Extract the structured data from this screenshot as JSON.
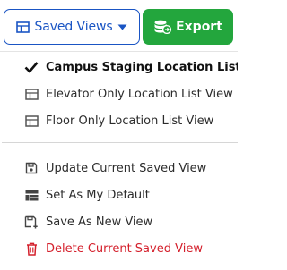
{
  "toolbar": {
    "saved_views_label": "Saved Views",
    "export_label": "Export",
    "colors": {
      "primary_blue": "#1a55c4",
      "export_green": "#23a63d"
    }
  },
  "menu": {
    "views": [
      {
        "label": "Campus Staging Location List View",
        "icon": "check-icon",
        "selected": true
      },
      {
        "label": "Elevator Only Location List View",
        "icon": "table-view-icon",
        "selected": false
      },
      {
        "label": "Floor Only Location List View",
        "icon": "table-view-icon",
        "selected": false
      }
    ],
    "actions": [
      {
        "label": "Update Current Saved View",
        "icon": "save-icon"
      },
      {
        "label": "Set As My Default",
        "icon": "default-table-icon"
      },
      {
        "label": "Save As New View",
        "icon": "save-as-new-icon"
      },
      {
        "label": "Delete Current Saved View",
        "icon": "trash-icon",
        "color": "#d4202c"
      }
    ]
  }
}
